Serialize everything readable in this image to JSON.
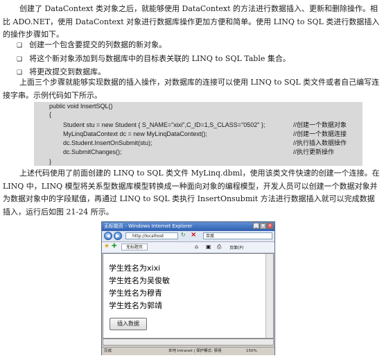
{
  "paragraphs": {
    "p1": "创建了 DataContext 类对象之后，就能够使用 DataContext 的方法进行数据插入、更新和删除操作。相比 ADO.NET，使用 DataContext 对象进行数据库操作更加方便和简单。使用 LINQ to SQL 类进行数据插入的操作步骤如下。",
    "bullets": [
      "创建一个包含要提交的列数据的新对象。",
      "将这个新对象添加到与数据库中的目标表关联的 LINQ to SQL Table 集合。",
      "将更改提交到数据库。"
    ],
    "p2": "上面三个步骤就能够实现数据的插入操作，对数据库的连接可以使用 LINQ to SQL 类文件或者自己编写连接字串。示例代码如下所示。",
    "p3": "上述代码使用了前面创建的 LINQ to SQL 类文件 MyLinq.dbml，使用该类文件快速的创建一个连接。在 LINQ 中，LINQ 模型将关系型数据库模型转换成一种面向对象的编程模型，开发人员可以创建一个数据对象并为数据对象中的字段赋值，再通过 LINQ to SQL 类执行 InsertOnsubmit 方法进行数据插入就可以完成数据插入，运行后如图 21-24 所示。"
  },
  "code": {
    "header": "public void InsertSQL()",
    "open": "{",
    "lines": [
      "Student stu = new Student { S_NAME=\"xixi\",C_ID=1,S_CLASS=\"0502\" };",
      "MyLinqDataContext dc = new MyLinqDataContext();",
      "dc.Student.InsertOnSubmit(stu);",
      "dc.SubmitChanges();"
    ],
    "comments": [
      "//创建一个数据对象",
      "//创建一个数据连接",
      "//执行插入数据操作",
      "//执行更新操作"
    ],
    "close": "}"
  },
  "browser": {
    "title": "无标题页 - Windows Internet Explorer",
    "address": "http://localhost",
    "search_placeholder": "百度",
    "tab_label": "无标题页",
    "toolbar_page": "页面(P)",
    "students": [
      "学生姓名为xixi",
      "学生姓名为吴俊敏",
      "学生姓名为穆青",
      "学生姓名为郭靖"
    ],
    "insert_button": "插入数据",
    "status_done": "完成",
    "status_zone": "本地 Intranet | 保护模式: 禁用",
    "status_zoom": "150%"
  }
}
